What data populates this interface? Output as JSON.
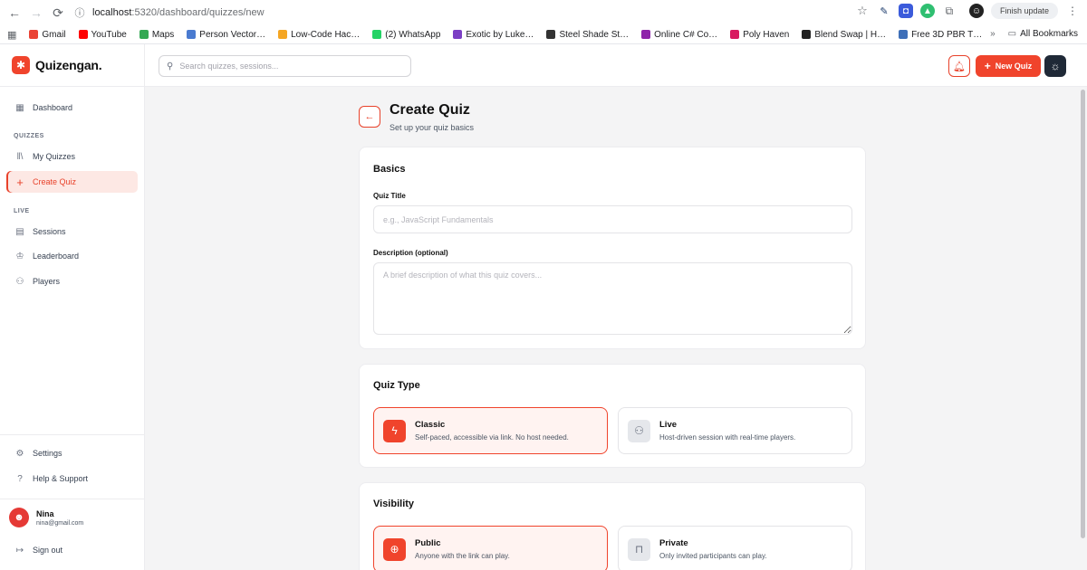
{
  "browser": {
    "url_host": "localhost",
    "url_path": ":5320/dashboard/quizzes/new",
    "finish_update": "Finish update",
    "bookmarks": [
      {
        "label": "Gmail",
        "color": "#ea4335"
      },
      {
        "label": "YouTube",
        "color": "#ff0000"
      },
      {
        "label": "Maps",
        "color": "#34a853"
      },
      {
        "label": "Person Vector…",
        "color": "#4a7bd0"
      },
      {
        "label": "Low-Code Hac…",
        "color": "#f5a623"
      },
      {
        "label": "(2) WhatsApp",
        "color": "#25d366"
      },
      {
        "label": "Exotic by Luke…",
        "color": "#7b3fc4"
      },
      {
        "label": "Steel Shade St…",
        "color": "#333333"
      },
      {
        "label": "Online C# Co…",
        "color": "#8e24aa"
      },
      {
        "label": "Poly Haven",
        "color": "#d81b60"
      },
      {
        "label": "Blend Swap | H…",
        "color": "#222222"
      },
      {
        "label": "Free 3D PBR T…",
        "color": "#3e6fb8"
      }
    ],
    "all_bookmarks": "All Bookmarks"
  },
  "app": {
    "brand": "Quizengan.",
    "search_placeholder": "Search quizzes, sessions...",
    "new_quiz_label": "New Quiz",
    "accent_color": "#f0442c"
  },
  "sidebar": {
    "dashboard": "Dashboard",
    "section_quizzes": "QUIZZES",
    "my_quizzes": "My Quizzes",
    "create_quiz": "Create Quiz",
    "section_live": "LIVE",
    "sessions": "Sessions",
    "leaderboard": "Leaderboard",
    "players": "Players",
    "settings": "Settings",
    "help": "Help & Support",
    "user_name": "Nina",
    "user_email": "nina@gmail.com",
    "sign_out": "Sign out"
  },
  "page": {
    "title": "Create Quiz",
    "subtitle": "Set up your quiz basics",
    "basics": {
      "title": "Basics",
      "quiz_title_label": "Quiz Title",
      "quiz_title_placeholder": "e.g., JavaScript Fundamentals",
      "quiz_title_value": "",
      "description_label": "Description (optional)",
      "description_placeholder": "A brief description of what this quiz covers...",
      "description_value": ""
    },
    "quiz_type": {
      "title": "Quiz Type",
      "classic_title": "Classic",
      "classic_desc": "Self-paced, accessible via link. No host needed.",
      "live_title": "Live",
      "live_desc": "Host-driven session with real-time players.",
      "selected": "Classic"
    },
    "visibility": {
      "title": "Visibility",
      "public_title": "Public",
      "public_desc": "Anyone with the link can play.",
      "private_title": "Private",
      "private_desc": "Only invited participants can play.",
      "selected": "Public"
    }
  }
}
